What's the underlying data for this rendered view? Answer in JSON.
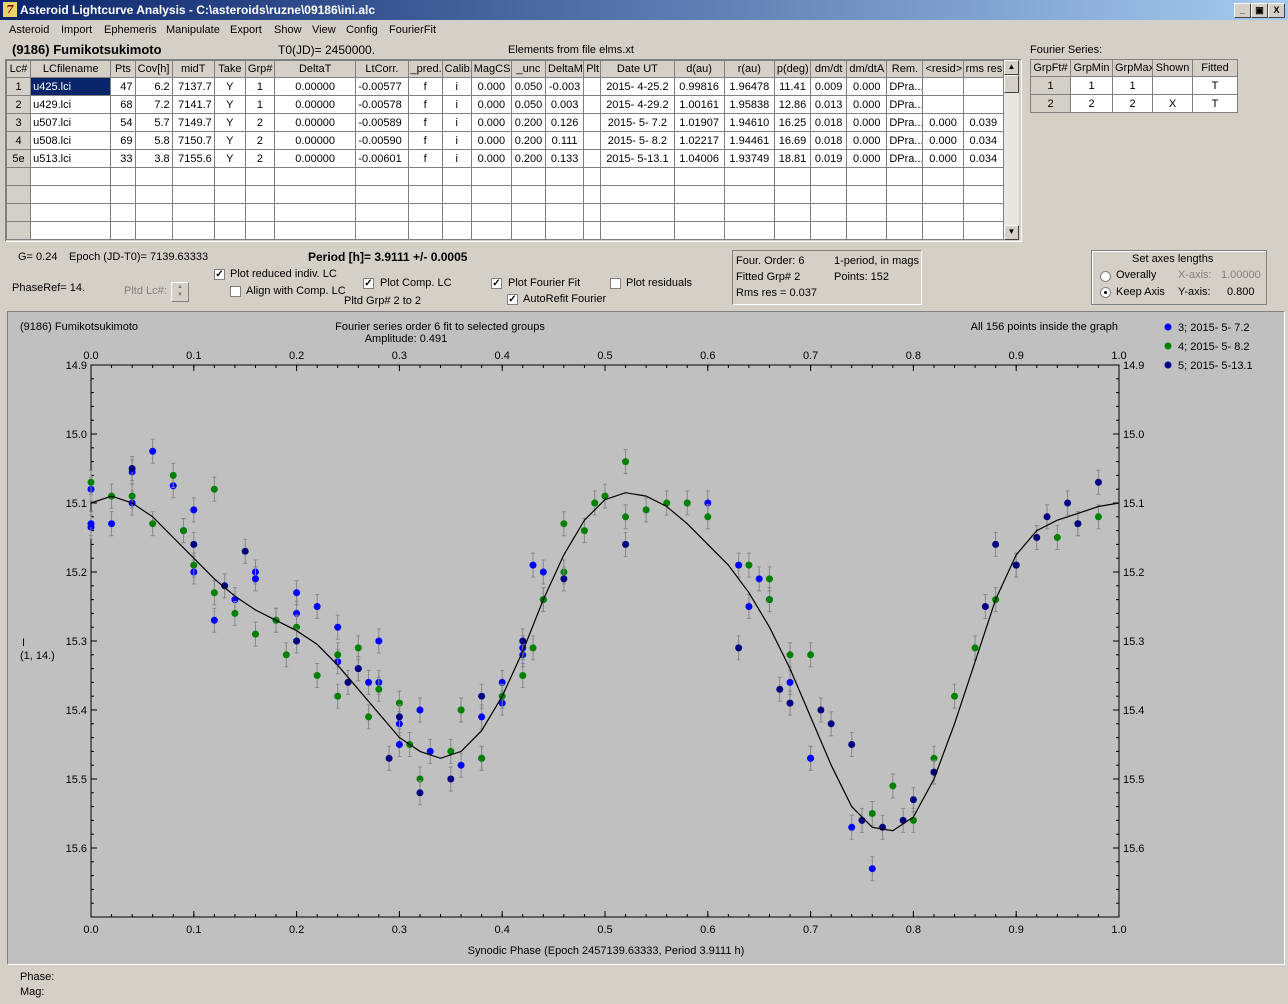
{
  "window": {
    "title": "Asteroid Lightcurve Analysis - C:\\asteroids\\ruzne\\09186\\ini.alc",
    "controls": [
      "_",
      "▣",
      "X"
    ]
  },
  "menu": [
    "Asteroid",
    "Import",
    "Ephemeris",
    "Manipulate",
    "Export",
    "Show",
    "View",
    "Config",
    "FourierFit"
  ],
  "header": {
    "asteroid": "(9186) Fumikotsukimoto",
    "t0": "T0(JD)= 2450000.",
    "elements": "Elements from file elms.xt"
  },
  "lc_table": {
    "columns": [
      "Lc#",
      "LCfilename",
      "Pts",
      "Cov[h]",
      "midT",
      "Take",
      "Grp#",
      "DeltaT",
      "LtCorr.",
      "_pred.",
      "Calib.",
      "MagCS",
      "_unc",
      "DeltaM",
      "Plt",
      "Date UT",
      "d(au)",
      "r(au)",
      "p(deg)",
      "dm/dt",
      "dm/dtA",
      "Rem.",
      "<resid>",
      "rms res"
    ],
    "rows": [
      [
        "1",
        "u425.lci",
        "47",
        "6.2",
        "7137.7",
        "Y",
        "1",
        "0.00000",
        "-0.00577",
        "f",
        "i",
        "0.000",
        "0.050",
        "-0.003",
        "",
        "2015- 4-25.2",
        "0.99816",
        "1.96478",
        "11.41",
        "0.009",
        "0.000",
        "DPra...",
        "",
        ""
      ],
      [
        "2",
        "u429.lci",
        "68",
        "7.2",
        "7141.7",
        "Y",
        "1",
        "0.00000",
        "-0.00578",
        "f",
        "i",
        "0.000",
        "0.050",
        "0.003",
        "",
        "2015- 4-29.2",
        "1.00161",
        "1.95838",
        "12.86",
        "0.013",
        "0.000",
        "DPra...",
        "",
        ""
      ],
      [
        "3",
        "u507.lci",
        "54",
        "5.7",
        "7149.7",
        "Y",
        "2",
        "0.00000",
        "-0.00589",
        "f",
        "i",
        "0.000",
        "0.200",
        "0.126",
        "",
        "2015- 5- 7.2",
        "1.01907",
        "1.94610",
        "16.25",
        "0.018",
        "0.000",
        "DPra...",
        "0.000",
        "0.039"
      ],
      [
        "4",
        "u508.lci",
        "69",
        "5.8",
        "7150.7",
        "Y",
        "2",
        "0.00000",
        "-0.00590",
        "f",
        "i",
        "0.000",
        "0.200",
        "0.111",
        "",
        "2015- 5- 8.2",
        "1.02217",
        "1.94461",
        "16.69",
        "0.018",
        "0.000",
        "DPra...",
        "0.000",
        "0.034"
      ],
      [
        "5e",
        "u513.lci",
        "33",
        "3.8",
        "7155.6",
        "Y",
        "2",
        "0.00000",
        "-0.00601",
        "f",
        "i",
        "0.000",
        "0.200",
        "0.133",
        "",
        "2015- 5-13.1",
        "1.04006",
        "1.93749",
        "18.81",
        "0.019",
        "0.000",
        "DPra...",
        "0.000",
        "0.034"
      ]
    ]
  },
  "fourier_series": {
    "label": "Fourier Series:",
    "columns": [
      "GrpFt#",
      "GrpMin",
      "GrpMax",
      "Shown",
      "Fitted"
    ],
    "rows": [
      [
        "1",
        "1",
        "1",
        "",
        "T"
      ],
      [
        "2",
        "2",
        "2",
        "X",
        "T"
      ]
    ]
  },
  "controls": {
    "g": "G= 0.24",
    "epoch": "Epoch (JD-T0)= 7139.63333",
    "period": "Period [h]= 3.9111 +/- 0.0005",
    "phaseref": "PhaseRef= 14.",
    "pltd_lc": "Pltd Lc#:",
    "plot_reduced": "Plot reduced indiv. LC",
    "align_comp": "Align with Comp. LC",
    "plot_comp": "Plot Comp. LC",
    "pltd_grp": "Pltd Grp#  2  to   2",
    "plot_fourier": "Plot Fourier Fit",
    "autorefit": "AutoRefit Fourier",
    "plot_residuals": "Plot residuals"
  },
  "info_box": {
    "order": "Four. Order:  6",
    "mode": "1-period, in mags",
    "grp": "Fitted Grp# 2",
    "points": "Points: 152",
    "rms": "Rms res     = 0.037"
  },
  "axes_box": {
    "title": "Set axes lengths",
    "overally": "Overally",
    "keep_axis": "Keep Axis",
    "xaxis_label": "X-axis:",
    "xaxis_value": "1.00000",
    "yaxis_label": "Y-axis:",
    "yaxis_value": "0.800"
  },
  "status": {
    "phase": "Phase:",
    "mag": "Mag:"
  },
  "chart_data": {
    "type": "scatter",
    "title_left": "(9186) Fumikotsukimoto",
    "title": "Fourier series order 6 fit to selected groups",
    "subtitle": "Amplitude: 0.491",
    "note_right": "All 156 points inside the graph",
    "xlabel": "Synodic Phase (Epoch 2457139.63333, Period 3.9111 h)",
    "ylabel": "I",
    "ylabel2": "(1, 14.)",
    "xlim": [
      0,
      1
    ],
    "ylim": [
      14.9,
      15.7
    ],
    "y_inverted": true,
    "xticks": [
      "0.0",
      "0.1",
      "0.2",
      "0.3",
      "0.4",
      "0.5",
      "0.6",
      "0.7",
      "0.8",
      "0.9",
      "1.0"
    ],
    "yticks": [
      "14.9",
      "15.0",
      "15.1",
      "15.2",
      "15.3",
      "15.4",
      "15.5",
      "15.6"
    ],
    "legend_position": "right",
    "background": "#c0c0c0",
    "series": [
      {
        "name": "3; 2015- 5- 7.2",
        "color": "#0000ff",
        "points": [
          [
            0.0,
            15.08
          ],
          [
            0.0,
            15.135
          ],
          [
            0.02,
            15.13
          ],
          [
            0.04,
            15.1
          ],
          [
            0.04,
            15.055
          ],
          [
            0.06,
            15.025
          ],
          [
            0.08,
            15.075
          ],
          [
            0.09,
            15.14
          ],
          [
            0.1,
            15.2
          ],
          [
            0.1,
            15.11
          ],
          [
            0.12,
            15.27
          ],
          [
            0.14,
            15.24
          ],
          [
            0.16,
            15.2
          ],
          [
            0.16,
            15.21
          ],
          [
            0.18,
            15.27
          ],
          [
            0.2,
            15.26
          ],
          [
            0.2,
            15.23
          ],
          [
            0.22,
            15.25
          ],
          [
            0.24,
            15.28
          ],
          [
            0.24,
            15.33
          ],
          [
            0.26,
            15.34
          ],
          [
            0.27,
            15.36
          ],
          [
            0.28,
            15.3
          ],
          [
            0.28,
            15.36
          ],
          [
            0.3,
            15.45
          ],
          [
            0.3,
            15.42
          ],
          [
            0.32,
            15.4
          ],
          [
            0.33,
            15.46
          ],
          [
            0.36,
            15.48
          ],
          [
            0.38,
            15.41
          ],
          [
            0.38,
            15.47
          ],
          [
            0.4,
            15.39
          ],
          [
            0.4,
            15.36
          ],
          [
            0.42,
            15.32
          ],
          [
            0.42,
            15.31
          ],
          [
            0.43,
            15.19
          ],
          [
            0.44,
            15.24
          ],
          [
            0.44,
            15.2
          ],
          [
            0.6,
            15.1
          ],
          [
            0.63,
            15.19
          ],
          [
            0.64,
            15.25
          ],
          [
            0.65,
            15.21
          ],
          [
            0.66,
            15.24
          ],
          [
            0.68,
            15.36
          ],
          [
            0.7,
            15.47
          ],
          [
            0.7,
            15.47
          ],
          [
            0.74,
            15.57
          ],
          [
            0.76,
            15.63
          ],
          [
            0.0,
            15.13
          ]
        ]
      },
      {
        "name": "4; 2015- 5- 8.2",
        "color": "#008000",
        "points": [
          [
            0.0,
            15.07
          ],
          [
            0.02,
            15.09
          ],
          [
            0.04,
            15.09
          ],
          [
            0.06,
            15.13
          ],
          [
            0.08,
            15.06
          ],
          [
            0.09,
            15.14
          ],
          [
            0.1,
            15.19
          ],
          [
            0.12,
            15.08
          ],
          [
            0.12,
            15.23
          ],
          [
            0.14,
            15.26
          ],
          [
            0.16,
            15.29
          ],
          [
            0.18,
            15.27
          ],
          [
            0.19,
            15.32
          ],
          [
            0.2,
            15.28
          ],
          [
            0.22,
            15.35
          ],
          [
            0.24,
            15.32
          ],
          [
            0.24,
            15.38
          ],
          [
            0.26,
            15.31
          ],
          [
            0.27,
            15.41
          ],
          [
            0.28,
            15.37
          ],
          [
            0.3,
            15.39
          ],
          [
            0.31,
            15.45
          ],
          [
            0.32,
            15.5
          ],
          [
            0.35,
            15.46
          ],
          [
            0.36,
            15.4
          ],
          [
            0.36,
            15.4
          ],
          [
            0.38,
            15.47
          ],
          [
            0.4,
            15.38
          ],
          [
            0.42,
            15.35
          ],
          [
            0.43,
            15.31
          ],
          [
            0.44,
            15.24
          ],
          [
            0.46,
            15.2
          ],
          [
            0.46,
            15.13
          ],
          [
            0.48,
            15.14
          ],
          [
            0.49,
            15.1
          ],
          [
            0.5,
            15.09
          ],
          [
            0.52,
            15.12
          ],
          [
            0.52,
            15.04
          ],
          [
            0.54,
            15.11
          ],
          [
            0.56,
            15.1
          ],
          [
            0.58,
            15.1
          ],
          [
            0.6,
            15.12
          ],
          [
            0.64,
            15.19
          ],
          [
            0.66,
            15.21
          ],
          [
            0.66,
            15.24
          ],
          [
            0.68,
            15.32
          ],
          [
            0.7,
            15.32
          ],
          [
            0.76,
            15.55
          ],
          [
            0.78,
            15.51
          ],
          [
            0.8,
            15.56
          ],
          [
            0.82,
            15.47
          ],
          [
            0.84,
            15.38
          ],
          [
            0.86,
            15.31
          ],
          [
            0.88,
            15.24
          ],
          [
            0.9,
            15.19
          ],
          [
            0.94,
            15.15
          ],
          [
            0.96,
            15.13
          ],
          [
            0.98,
            15.12
          ]
        ]
      },
      {
        "name": "5; 2015- 5-13.1",
        "color": "#000080",
        "points": [
          [
            0.04,
            15.05
          ],
          [
            0.1,
            15.16
          ],
          [
            0.13,
            15.22
          ],
          [
            0.15,
            15.17
          ],
          [
            0.2,
            15.3
          ],
          [
            0.25,
            15.36
          ],
          [
            0.26,
            15.34
          ],
          [
            0.3,
            15.41
          ],
          [
            0.29,
            15.47
          ],
          [
            0.32,
            15.52
          ],
          [
            0.35,
            15.5
          ],
          [
            0.38,
            15.38
          ],
          [
            0.42,
            15.3
          ],
          [
            0.46,
            15.21
          ],
          [
            0.52,
            15.16
          ],
          [
            0.63,
            15.31
          ],
          [
            0.67,
            15.37
          ],
          [
            0.68,
            15.39
          ],
          [
            0.71,
            15.4
          ],
          [
            0.72,
            15.42
          ],
          [
            0.74,
            15.45
          ],
          [
            0.75,
            15.56
          ],
          [
            0.77,
            15.57
          ],
          [
            0.79,
            15.56
          ],
          [
            0.8,
            15.53
          ],
          [
            0.82,
            15.49
          ],
          [
            0.87,
            15.25
          ],
          [
            0.88,
            15.16
          ],
          [
            0.9,
            15.19
          ],
          [
            0.92,
            15.15
          ],
          [
            0.93,
            15.12
          ],
          [
            0.95,
            15.1
          ],
          [
            0.96,
            15.13
          ],
          [
            0.98,
            15.07
          ]
        ]
      }
    ],
    "fit_curve": [
      [
        0.0,
        15.1
      ],
      [
        0.02,
        15.09
      ],
      [
        0.04,
        15.1
      ],
      [
        0.06,
        15.12
      ],
      [
        0.08,
        15.15
      ],
      [
        0.1,
        15.18
      ],
      [
        0.12,
        15.21
      ],
      [
        0.14,
        15.235
      ],
      [
        0.16,
        15.255
      ],
      [
        0.18,
        15.27
      ],
      [
        0.2,
        15.285
      ],
      [
        0.22,
        15.305
      ],
      [
        0.24,
        15.335
      ],
      [
        0.26,
        15.37
      ],
      [
        0.28,
        15.405
      ],
      [
        0.3,
        15.44
      ],
      [
        0.32,
        15.46
      ],
      [
        0.34,
        15.47
      ],
      [
        0.36,
        15.46
      ],
      [
        0.38,
        15.43
      ],
      [
        0.4,
        15.38
      ],
      [
        0.42,
        15.315
      ],
      [
        0.44,
        15.24
      ],
      [
        0.46,
        15.175
      ],
      [
        0.48,
        15.125
      ],
      [
        0.5,
        15.095
      ],
      [
        0.52,
        15.085
      ],
      [
        0.54,
        15.09
      ],
      [
        0.56,
        15.105
      ],
      [
        0.58,
        15.13
      ],
      [
        0.6,
        15.16
      ],
      [
        0.62,
        15.19
      ],
      [
        0.64,
        15.23
      ],
      [
        0.66,
        15.28
      ],
      [
        0.68,
        15.34
      ],
      [
        0.7,
        15.41
      ],
      [
        0.72,
        15.48
      ],
      [
        0.74,
        15.54
      ],
      [
        0.76,
        15.57
      ],
      [
        0.78,
        15.575
      ],
      [
        0.8,
        15.555
      ],
      [
        0.82,
        15.5
      ],
      [
        0.84,
        15.42
      ],
      [
        0.86,
        15.33
      ],
      [
        0.88,
        15.24
      ],
      [
        0.9,
        15.175
      ],
      [
        0.92,
        15.14
      ],
      [
        0.94,
        15.125
      ],
      [
        0.96,
        15.115
      ],
      [
        0.98,
        15.105
      ],
      [
        1.0,
        15.1
      ]
    ]
  }
}
